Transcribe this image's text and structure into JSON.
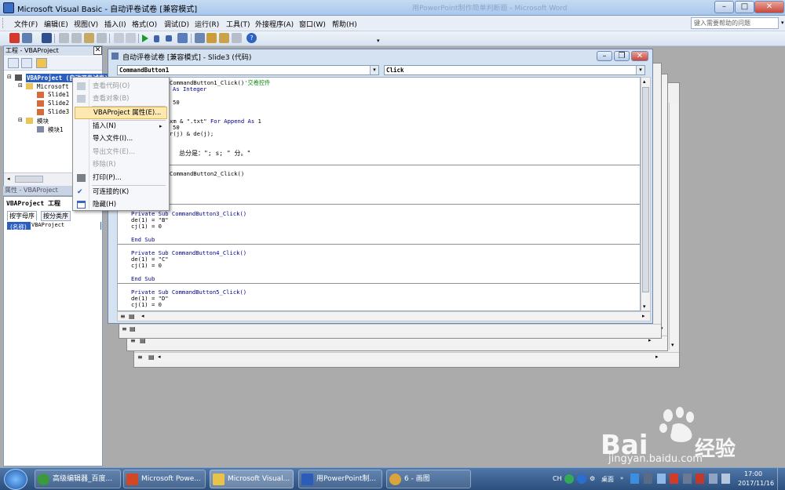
{
  "window": {
    "title": "Microsoft Visual Basic - 自动评卷试卷 [兼容模式]",
    "background_title": "用PowerPoint制作简单判断题 - Microsoft Word"
  },
  "menubar": {
    "items": [
      "文件(F)",
      "编辑(E)",
      "视图(V)",
      "插入(I)",
      "格式(O)",
      "调试(D)",
      "运行(R)",
      "工具(T)",
      "外接程序(A)",
      "窗口(W)",
      "帮助(H)"
    ],
    "help_placeholder": "键入需要帮助的问题"
  },
  "project": {
    "title": "工程 - VBAProject",
    "root": "VBAProject (自动评卷试卷)",
    "folder1": "Microsoft PowerPoint 对象",
    "slides": [
      "Slide1",
      "Slide2",
      "Slide3"
    ],
    "modules_folder": "模块",
    "module1": "模块1"
  },
  "properties": {
    "title": "属性 - VBAProject",
    "object": "VBAProject 工程",
    "tabs": [
      "按字母序",
      "按分类序"
    ],
    "row_name": "(名称)",
    "row_value": "VBAProject"
  },
  "code_window": {
    "title": "自动评卷试卷 [兼容模式] - Slide3 (代码)",
    "object_select": "CommandButton1",
    "proc_select": "Click",
    "lines": {
      "l1": "CommandButton1_Click()",
      "l1c": "'交卷控件",
      "l2": "As Integer",
      "l3": "50",
      "l4a": "xm & \".txt\"",
      "l4b": "For Append As",
      "l4c": "1",
      "l5": "50",
      "l6": "r(j) & de(j);",
      "l7": "总分是：\"; s; \" 分。\"",
      "l8": "CommandButton2_Click()",
      "p3": "Private Sub CommandButton3_Click()",
      "p3a": "de(1) = \"B\"",
      "p3b": "cj(1) = 0",
      "end1": "End Sub",
      "p4": "Private Sub CommandButton4_Click()",
      "p4a": "de(1) = \"C\"",
      "p4b": "cj(1) = 0",
      "end2": "End Sub",
      "p5": "Private Sub CommandButton5_Click()",
      "p5a": "de(1) = \"D\"",
      "p5b": "cj(1) = 0"
    }
  },
  "context_menu": {
    "items": [
      "查看代码(O)",
      "查看对象(B)",
      "VBAProject 属性(E)...",
      "插入(N)",
      "导入文件(I)...",
      "导出文件(E)...",
      "移除(R)",
      "打印(P)...",
      "可连接的(K)",
      "隐藏(H)"
    ]
  },
  "taskbar": {
    "tasks": [
      "高级编辑器_百度...",
      "Microsoft Powe...",
      "Microsoft Visual...",
      "用PowerPoint制...",
      "6 - 画图"
    ],
    "ime": "CH",
    "desktop": "桌面",
    "time": "17:00",
    "date": "2017/11/16"
  },
  "watermark": {
    "brand": "Bai",
    "brand2": "经验",
    "url": "jingyan.baidu.com"
  },
  "colors": {
    "keyword": "#00008b",
    "comment": "#0a8a0a",
    "highlight": "#fde8b2"
  }
}
